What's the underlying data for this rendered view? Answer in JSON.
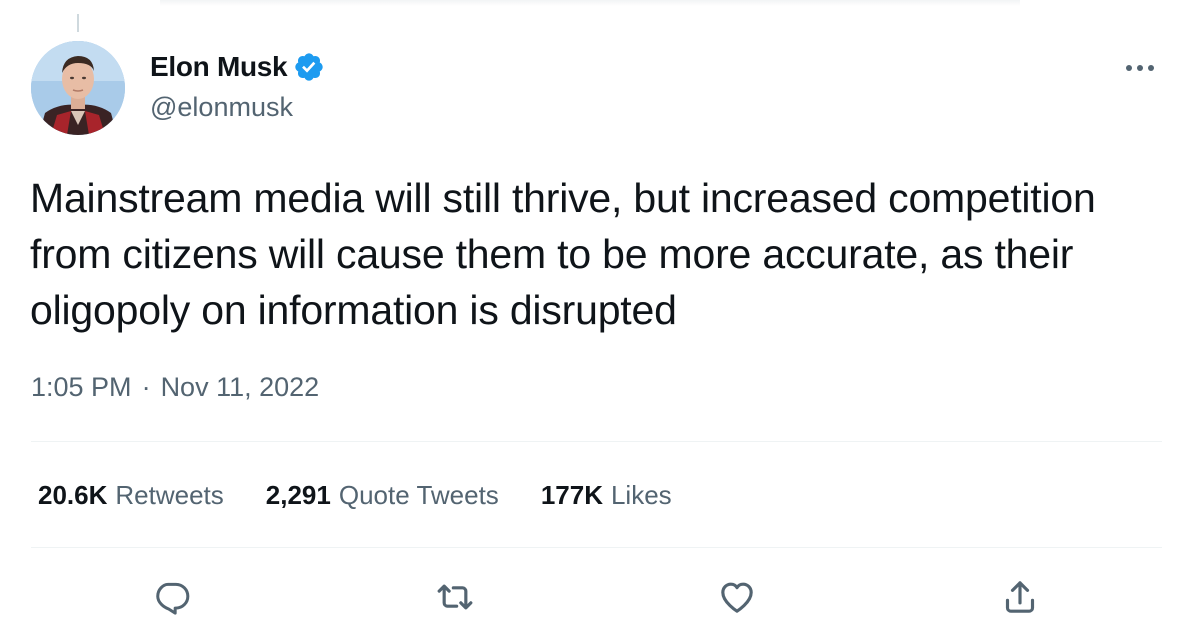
{
  "author": {
    "display_name": "Elon Musk",
    "handle": "@elonmusk",
    "verified": true,
    "verified_color": "#1d9bf0"
  },
  "tweet": {
    "text": "Mainstream media will still thrive, but increased competition from citizens will cause them to be more accurate, as their oligopoly on information is disrupted",
    "time": "1:05 PM",
    "separator": "·",
    "date": "Nov 11, 2022"
  },
  "stats": {
    "retweets": {
      "count": "20.6K",
      "label": "Retweets"
    },
    "quote_tweets": {
      "count": "2,291",
      "label": "Quote Tweets"
    },
    "likes": {
      "count": "177K",
      "label": "Likes"
    }
  },
  "colors": {
    "text_primary": "#0f1419",
    "text_secondary": "#536471",
    "divider": "#eff3f4",
    "accent": "#1d9bf0"
  },
  "icons": {
    "more": "more-horizontal-icon",
    "reply": "reply-icon",
    "retweet": "retweet-icon",
    "like": "heart-icon",
    "share": "share-icon"
  }
}
